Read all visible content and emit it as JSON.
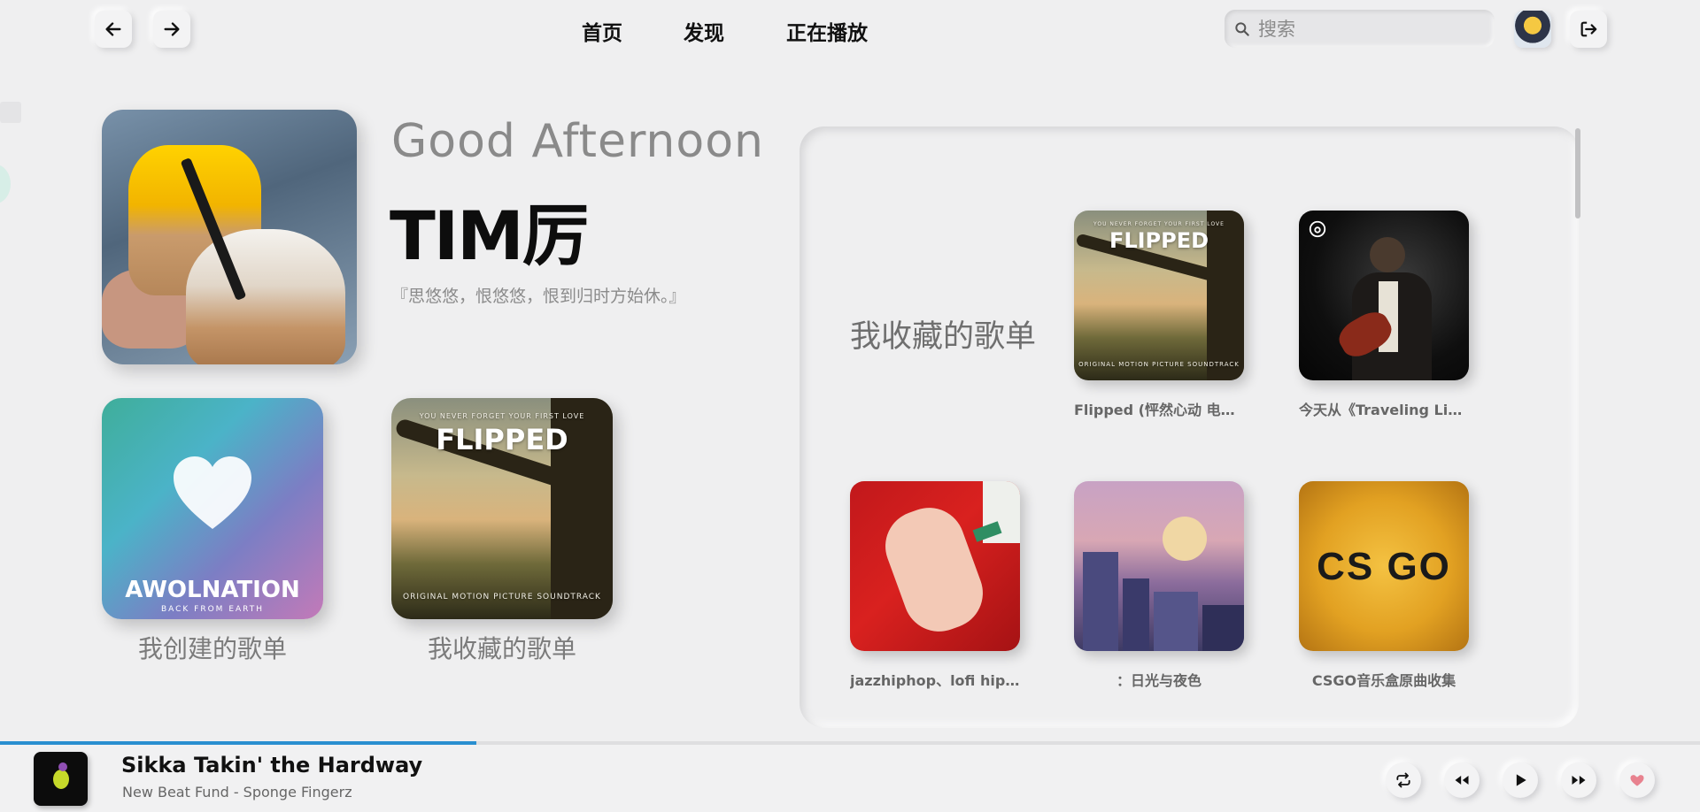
{
  "nav": {
    "back_icon": "arrow-left-icon",
    "forward_icon": "arrow-right-icon",
    "menu": [
      "首页",
      "发现",
      "正在播放"
    ],
    "search_placeholder": "搜索",
    "logout_icon": "logout-icon"
  },
  "hero": {
    "greeting": "Good Afternoon",
    "username": "TIM厉",
    "motto": "『思悠悠，恨悠悠，恨到归时方始休。』"
  },
  "cards": {
    "created": {
      "label": "我创建的歌单",
      "cover_text": "AWOLNATION",
      "cover_sub": "BACK FROM EARTH"
    },
    "collected": {
      "label": "我收藏的歌单",
      "cover_top": "YOU NEVER FORGET YOUR FIRST LOVE",
      "cover_title": "FLIPPED",
      "cover_bottom": "ORIGINAL MOTION PICTURE SOUNDTRACK"
    }
  },
  "panel": {
    "title": "我收藏的歌单",
    "playlists": [
      {
        "name": "Flipped (怦然心动 电影...",
        "cover": "flipped"
      },
      {
        "name": "今天从《Traveling Lig...",
        "cover": "guitar"
      },
      {
        "name": "jazzhiphop、lofi hipho...",
        "cover": "lofi"
      },
      {
        "name": "：日光与夜色",
        "cover": "city"
      },
      {
        "name": "CSGO音乐盒原曲收集",
        "cover": "csgo"
      }
    ],
    "csgo_text": "CS GO"
  },
  "player": {
    "title": "Sikka Takin' the Hardway",
    "artist": "New Beat Fund - Sponge Fingerz",
    "progress": 0.28,
    "controls": [
      "repeat-icon",
      "previous-icon",
      "play-icon",
      "next-icon",
      "heart-icon"
    ],
    "accent": "#2a8fd0",
    "heart_color": "#e8828f"
  }
}
